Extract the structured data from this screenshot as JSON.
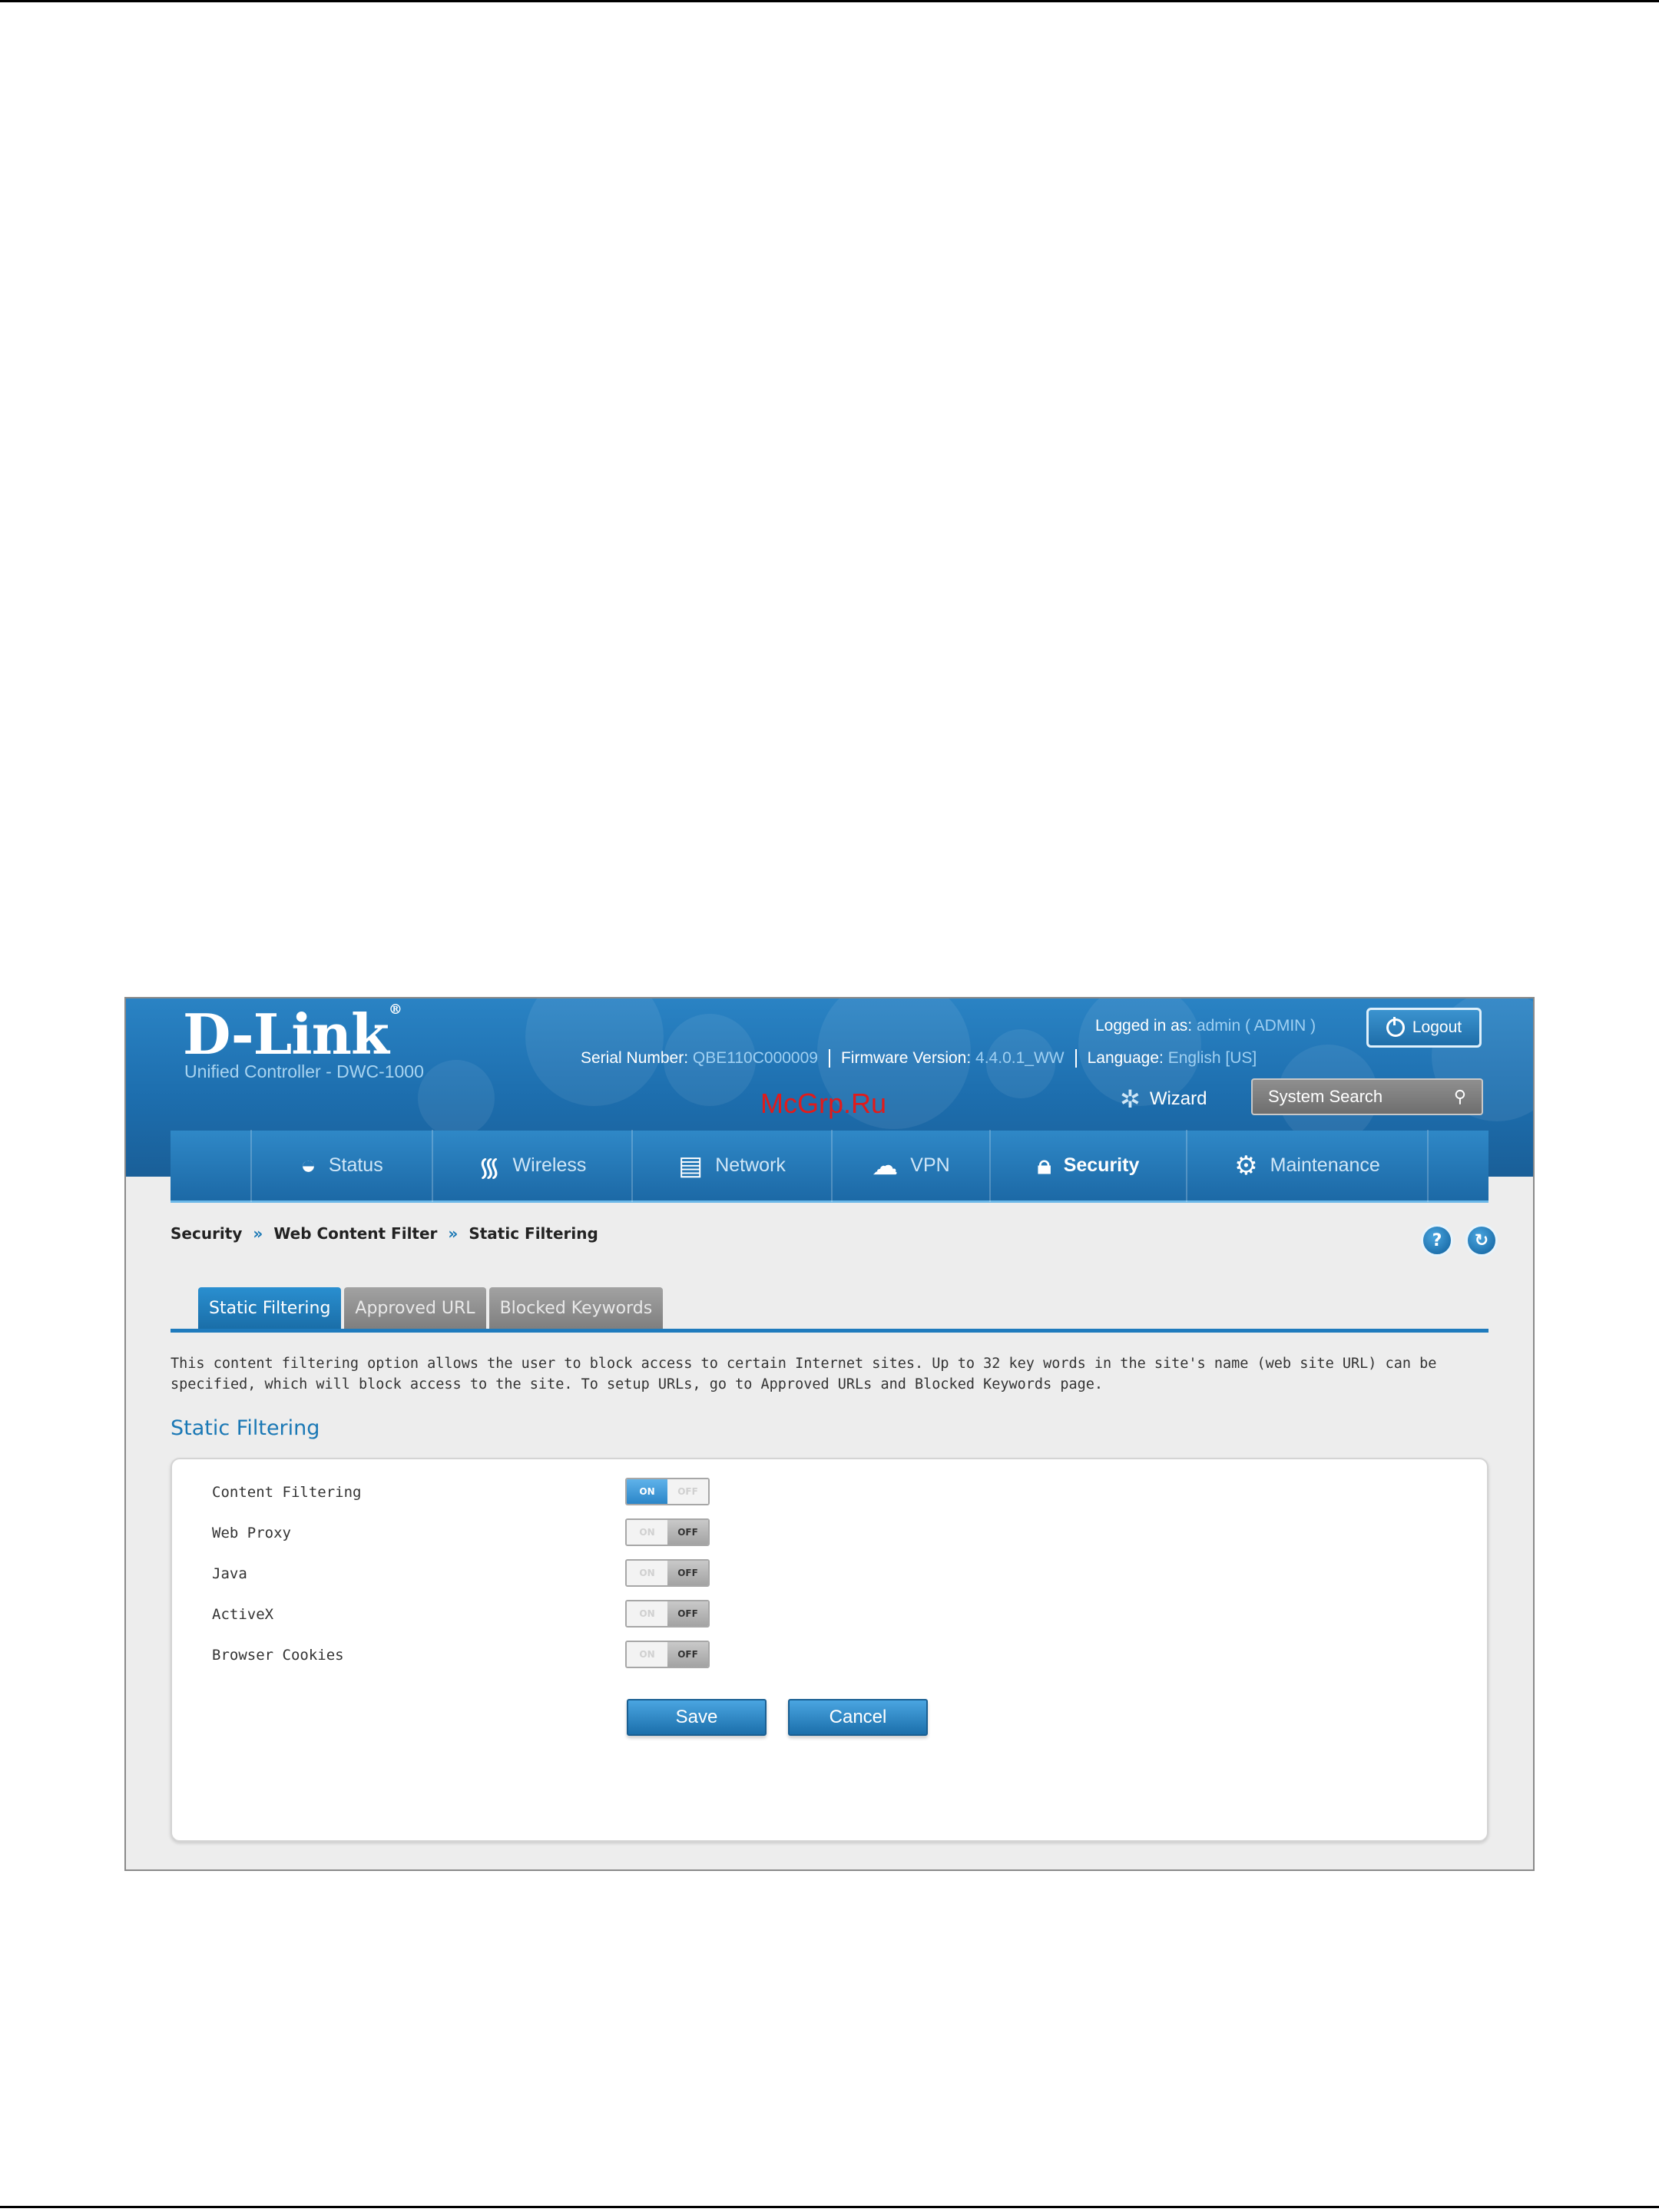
{
  "header": {
    "logo": "D-Link",
    "logo_mark": "®",
    "subtitle": "Unified Controller - DWC-1000",
    "logged_in_label": "Logged in as:",
    "logged_in_user": "admin ( ADMIN )",
    "logout_label": "Logout",
    "serial_label": "Serial Number:",
    "serial_value": "QBE110C000009",
    "firmware_label": "Firmware Version:",
    "firmware_value": "4.4.0.1_WW",
    "language_label": "Language:",
    "language_value": "English [US]",
    "wizard_label": "Wizard",
    "search_placeholder": "System Search",
    "watermark": "McGrp.Ru"
  },
  "nav": {
    "items": [
      {
        "label": "Status",
        "icon": "gauge-icon"
      },
      {
        "label": "Wireless",
        "icon": "wifi-icon"
      },
      {
        "label": "Network",
        "icon": "server-icon"
      },
      {
        "label": "VPN",
        "icon": "cloud-icon"
      },
      {
        "label": "Security",
        "icon": "lock-icon",
        "active": true
      },
      {
        "label": "Maintenance",
        "icon": "gears-icon"
      }
    ]
  },
  "breadcrumb": {
    "items": [
      "Security",
      "Web Content Filter",
      "Static Filtering"
    ],
    "separator": "»"
  },
  "icons": {
    "help": "help-icon",
    "refresh": "refresh-icon"
  },
  "tabs": [
    {
      "label": "Static Filtering",
      "active": true
    },
    {
      "label": "Approved URL",
      "active": false
    },
    {
      "label": "Blocked Keywords",
      "active": false
    }
  ],
  "description_line1": "This content filtering option allows the user to block access to certain Internet sites. Up to 32 key words in the site's name (web site URL) can be",
  "description_line2": "specified, which will block access to the site. To setup URLs, go to Approved URLs and Blocked Keywords page.",
  "section_title": "Static Filtering",
  "settings": [
    {
      "label": "Content Filtering",
      "state": "on",
      "on_text": "ON",
      "off_text": "OFF"
    },
    {
      "label": "Web Proxy",
      "state": "off",
      "on_text": "ON",
      "off_text": "OFF"
    },
    {
      "label": "Java",
      "state": "off",
      "on_text": "ON",
      "off_text": "OFF"
    },
    {
      "label": "ActiveX",
      "state": "off",
      "on_text": "ON",
      "off_text": "OFF"
    },
    {
      "label": "Browser Cookies",
      "state": "off",
      "on_text": "ON",
      "off_text": "OFF"
    }
  ],
  "buttons": {
    "save": "Save",
    "cancel": "Cancel"
  },
  "colors": {
    "brand_blue": "#1d6eae",
    "accent_link": "#1a78b5",
    "watermark_red": "#e11b1b"
  }
}
